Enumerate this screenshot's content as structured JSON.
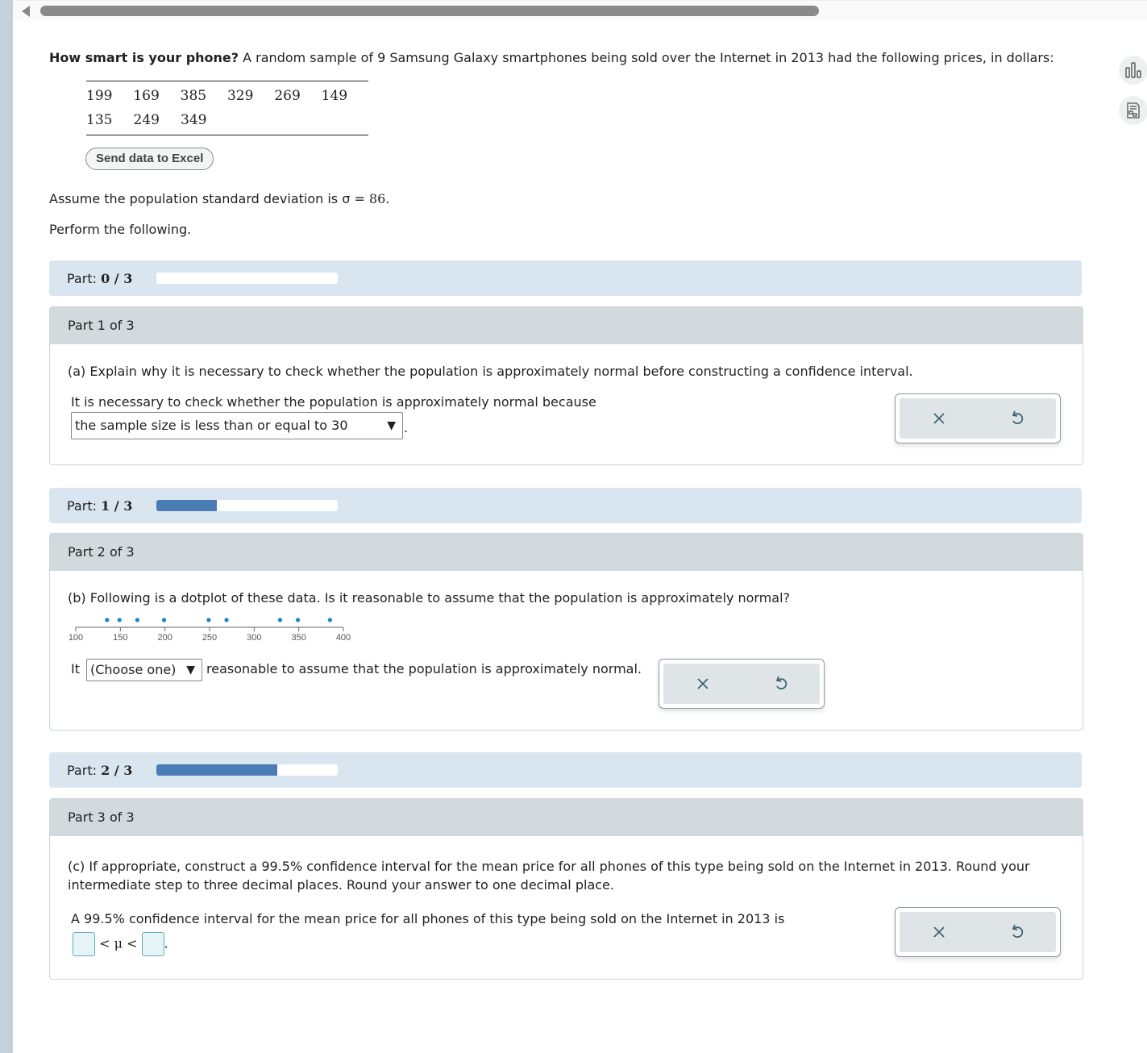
{
  "scrollbar": {
    "arrow": "left-arrow-icon"
  },
  "side_tools": [
    {
      "name": "bar-chart-icon"
    },
    {
      "name": "calculator-icon"
    }
  ],
  "intro": {
    "bold": "How smart is your phone?",
    "text": " A random sample of 9 Samsung Galaxy smartphones being sold over the Internet in 2013 had the following prices, in dollars:"
  },
  "data_table": {
    "rows": [
      [
        "199",
        "169",
        "385",
        "329",
        "269",
        "149"
      ],
      [
        "135",
        "249",
        "349"
      ]
    ]
  },
  "excel_button": "Send data to Excel",
  "assume_text": "Assume the population standard deviation is σ = ",
  "sigma_value": "86.",
  "perform_text": "Perform the following.",
  "progress": [
    {
      "label": "Part:",
      "value": "0 / 3",
      "fraction": 0.0
    },
    {
      "label": "Part:",
      "value": "1 / 3",
      "fraction": 0.333
    },
    {
      "label": "Part:",
      "value": "2 / 3",
      "fraction": 0.667
    }
  ],
  "parts": [
    {
      "header": "Part 1 of 3",
      "question": "(a) Explain why it is necessary to check whether the population is approximately normal before constructing a confidence interval.",
      "prompt": "It is necessary to check whether the population is approximately normal because",
      "select_value": "the sample size is less than or equal to 30",
      "suffix": "."
    },
    {
      "header": "Part 2 of 3",
      "question": "(b) Following is a dotplot of these data. Is it reasonable to assume that the population is approximately normal?",
      "prefix": "It",
      "select_value": "(Choose one)",
      "suffix": "reasonable to assume that the population is approximately normal."
    },
    {
      "header": "Part 3 of 3",
      "question": "(c) If appropriate, construct a 99.5% confidence interval for the mean price for all phones of this type being sold on the Internet in 2013. Round your intermediate step to three decimal places. Round your answer to one decimal place.",
      "prompt": "A 99.5% confidence interval for the mean price for all phones of this type being sold on the Internet in 2013 is",
      "lower_value": "",
      "upper_value": "",
      "relation": "< μ <",
      "suffix": "."
    }
  ],
  "dotplot": {
    "points": [
      135,
      149,
      169,
      199,
      249,
      269,
      329,
      349,
      385
    ],
    "ticks": [
      "100",
      "150",
      "200",
      "250",
      "300",
      "350",
      "400"
    ],
    "range": [
      100,
      400
    ],
    "color": "#1a85c8"
  },
  "actions": {
    "clear": "close-icon",
    "undo": "undo-icon"
  }
}
